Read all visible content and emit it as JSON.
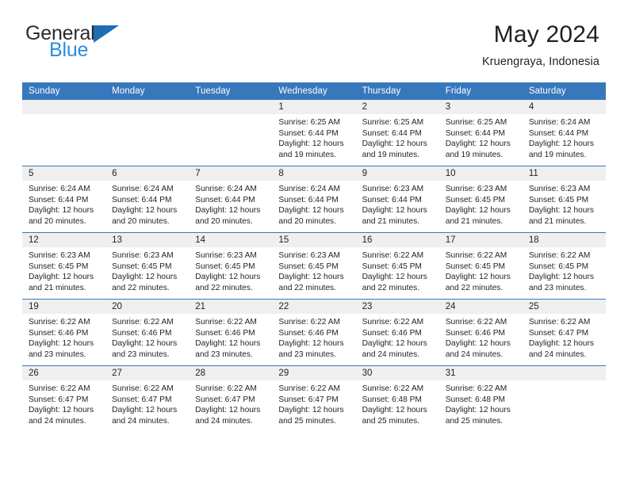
{
  "brand": {
    "name_line1": "General",
    "name_line2": "Blue",
    "logo_icon": "triangle-logo-icon",
    "accent_color": "#2d8ddb",
    "header_color": "#3777bc"
  },
  "header": {
    "title": "May 2024",
    "subtitle": "Kruengraya, Indonesia"
  },
  "calendar": {
    "weekday_headers": [
      "Sunday",
      "Monday",
      "Tuesday",
      "Wednesday",
      "Thursday",
      "Friday",
      "Saturday"
    ],
    "labels": {
      "sunrise": "Sunrise:",
      "sunset": "Sunset:",
      "daylight": "Daylight:"
    },
    "weeks": [
      [
        {
          "day": "",
          "sunrise": "",
          "sunset": "",
          "daylight_line1": "",
          "daylight_line2": ""
        },
        {
          "day": "",
          "sunrise": "",
          "sunset": "",
          "daylight_line1": "",
          "daylight_line2": ""
        },
        {
          "day": "",
          "sunrise": "",
          "sunset": "",
          "daylight_line1": "",
          "daylight_line2": ""
        },
        {
          "day": "1",
          "sunrise": "Sunrise: 6:25 AM",
          "sunset": "Sunset: 6:44 PM",
          "daylight_line1": "Daylight: 12 hours",
          "daylight_line2": "and 19 minutes."
        },
        {
          "day": "2",
          "sunrise": "Sunrise: 6:25 AM",
          "sunset": "Sunset: 6:44 PM",
          "daylight_line1": "Daylight: 12 hours",
          "daylight_line2": "and 19 minutes."
        },
        {
          "day": "3",
          "sunrise": "Sunrise: 6:25 AM",
          "sunset": "Sunset: 6:44 PM",
          "daylight_line1": "Daylight: 12 hours",
          "daylight_line2": "and 19 minutes."
        },
        {
          "day": "4",
          "sunrise": "Sunrise: 6:24 AM",
          "sunset": "Sunset: 6:44 PM",
          "daylight_line1": "Daylight: 12 hours",
          "daylight_line2": "and 19 minutes."
        }
      ],
      [
        {
          "day": "5",
          "sunrise": "Sunrise: 6:24 AM",
          "sunset": "Sunset: 6:44 PM",
          "daylight_line1": "Daylight: 12 hours",
          "daylight_line2": "and 20 minutes."
        },
        {
          "day": "6",
          "sunrise": "Sunrise: 6:24 AM",
          "sunset": "Sunset: 6:44 PM",
          "daylight_line1": "Daylight: 12 hours",
          "daylight_line2": "and 20 minutes."
        },
        {
          "day": "7",
          "sunrise": "Sunrise: 6:24 AM",
          "sunset": "Sunset: 6:44 PM",
          "daylight_line1": "Daylight: 12 hours",
          "daylight_line2": "and 20 minutes."
        },
        {
          "day": "8",
          "sunrise": "Sunrise: 6:24 AM",
          "sunset": "Sunset: 6:44 PM",
          "daylight_line1": "Daylight: 12 hours",
          "daylight_line2": "and 20 minutes."
        },
        {
          "day": "9",
          "sunrise": "Sunrise: 6:23 AM",
          "sunset": "Sunset: 6:44 PM",
          "daylight_line1": "Daylight: 12 hours",
          "daylight_line2": "and 21 minutes."
        },
        {
          "day": "10",
          "sunrise": "Sunrise: 6:23 AM",
          "sunset": "Sunset: 6:45 PM",
          "daylight_line1": "Daylight: 12 hours",
          "daylight_line2": "and 21 minutes."
        },
        {
          "day": "11",
          "sunrise": "Sunrise: 6:23 AM",
          "sunset": "Sunset: 6:45 PM",
          "daylight_line1": "Daylight: 12 hours",
          "daylight_line2": "and 21 minutes."
        }
      ],
      [
        {
          "day": "12",
          "sunrise": "Sunrise: 6:23 AM",
          "sunset": "Sunset: 6:45 PM",
          "daylight_line1": "Daylight: 12 hours",
          "daylight_line2": "and 21 minutes."
        },
        {
          "day": "13",
          "sunrise": "Sunrise: 6:23 AM",
          "sunset": "Sunset: 6:45 PM",
          "daylight_line1": "Daylight: 12 hours",
          "daylight_line2": "and 22 minutes."
        },
        {
          "day": "14",
          "sunrise": "Sunrise: 6:23 AM",
          "sunset": "Sunset: 6:45 PM",
          "daylight_line1": "Daylight: 12 hours",
          "daylight_line2": "and 22 minutes."
        },
        {
          "day": "15",
          "sunrise": "Sunrise: 6:23 AM",
          "sunset": "Sunset: 6:45 PM",
          "daylight_line1": "Daylight: 12 hours",
          "daylight_line2": "and 22 minutes."
        },
        {
          "day": "16",
          "sunrise": "Sunrise: 6:22 AM",
          "sunset": "Sunset: 6:45 PM",
          "daylight_line1": "Daylight: 12 hours",
          "daylight_line2": "and 22 minutes."
        },
        {
          "day": "17",
          "sunrise": "Sunrise: 6:22 AM",
          "sunset": "Sunset: 6:45 PM",
          "daylight_line1": "Daylight: 12 hours",
          "daylight_line2": "and 22 minutes."
        },
        {
          "day": "18",
          "sunrise": "Sunrise: 6:22 AM",
          "sunset": "Sunset: 6:45 PM",
          "daylight_line1": "Daylight: 12 hours",
          "daylight_line2": "and 23 minutes."
        }
      ],
      [
        {
          "day": "19",
          "sunrise": "Sunrise: 6:22 AM",
          "sunset": "Sunset: 6:46 PM",
          "daylight_line1": "Daylight: 12 hours",
          "daylight_line2": "and 23 minutes."
        },
        {
          "day": "20",
          "sunrise": "Sunrise: 6:22 AM",
          "sunset": "Sunset: 6:46 PM",
          "daylight_line1": "Daylight: 12 hours",
          "daylight_line2": "and 23 minutes."
        },
        {
          "day": "21",
          "sunrise": "Sunrise: 6:22 AM",
          "sunset": "Sunset: 6:46 PM",
          "daylight_line1": "Daylight: 12 hours",
          "daylight_line2": "and 23 minutes."
        },
        {
          "day": "22",
          "sunrise": "Sunrise: 6:22 AM",
          "sunset": "Sunset: 6:46 PM",
          "daylight_line1": "Daylight: 12 hours",
          "daylight_line2": "and 23 minutes."
        },
        {
          "day": "23",
          "sunrise": "Sunrise: 6:22 AM",
          "sunset": "Sunset: 6:46 PM",
          "daylight_line1": "Daylight: 12 hours",
          "daylight_line2": "and 24 minutes."
        },
        {
          "day": "24",
          "sunrise": "Sunrise: 6:22 AM",
          "sunset": "Sunset: 6:46 PM",
          "daylight_line1": "Daylight: 12 hours",
          "daylight_line2": "and 24 minutes."
        },
        {
          "day": "25",
          "sunrise": "Sunrise: 6:22 AM",
          "sunset": "Sunset: 6:47 PM",
          "daylight_line1": "Daylight: 12 hours",
          "daylight_line2": "and 24 minutes."
        }
      ],
      [
        {
          "day": "26",
          "sunrise": "Sunrise: 6:22 AM",
          "sunset": "Sunset: 6:47 PM",
          "daylight_line1": "Daylight: 12 hours",
          "daylight_line2": "and 24 minutes."
        },
        {
          "day": "27",
          "sunrise": "Sunrise: 6:22 AM",
          "sunset": "Sunset: 6:47 PM",
          "daylight_line1": "Daylight: 12 hours",
          "daylight_line2": "and 24 minutes."
        },
        {
          "day": "28",
          "sunrise": "Sunrise: 6:22 AM",
          "sunset": "Sunset: 6:47 PM",
          "daylight_line1": "Daylight: 12 hours",
          "daylight_line2": "and 24 minutes."
        },
        {
          "day": "29",
          "sunrise": "Sunrise: 6:22 AM",
          "sunset": "Sunset: 6:47 PM",
          "daylight_line1": "Daylight: 12 hours",
          "daylight_line2": "and 25 minutes."
        },
        {
          "day": "30",
          "sunrise": "Sunrise: 6:22 AM",
          "sunset": "Sunset: 6:48 PM",
          "daylight_line1": "Daylight: 12 hours",
          "daylight_line2": "and 25 minutes."
        },
        {
          "day": "31",
          "sunrise": "Sunrise: 6:22 AM",
          "sunset": "Sunset: 6:48 PM",
          "daylight_line1": "Daylight: 12 hours",
          "daylight_line2": "and 25 minutes."
        },
        {
          "day": "",
          "sunrise": "",
          "sunset": "",
          "daylight_line1": "",
          "daylight_line2": ""
        }
      ]
    ]
  }
}
